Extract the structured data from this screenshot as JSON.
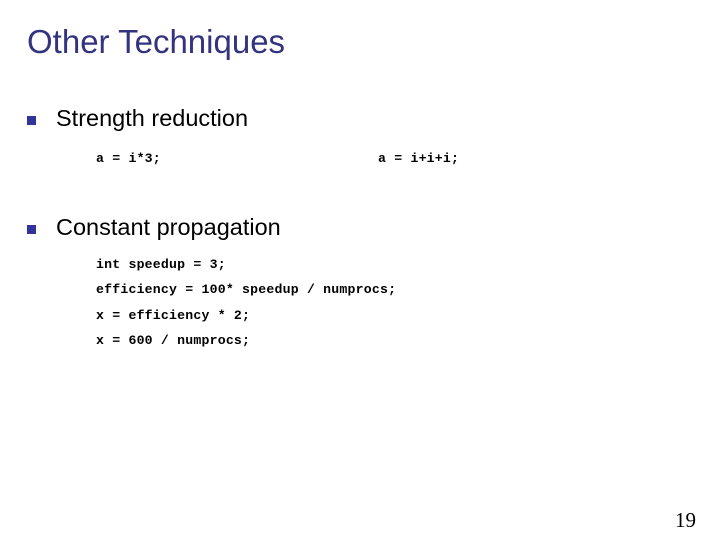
{
  "slide": {
    "title": "Other Techniques",
    "page_number": "19",
    "colors": {
      "title": "#33337f",
      "bullet_marker": "#33339c",
      "body_text": "#000000",
      "background": "#ffffff"
    },
    "bullets": [
      {
        "label": "Strength reduction",
        "code_before": "a = i*3;",
        "code_after": "a = i+i+i;"
      },
      {
        "label": "Constant propagation",
        "code_lines": [
          "int speedup = 3;",
          "efficiency = 100* speedup / numprocs;",
          "x = efficiency * 2;",
          "x = 600 / numprocs;"
        ]
      }
    ]
  }
}
